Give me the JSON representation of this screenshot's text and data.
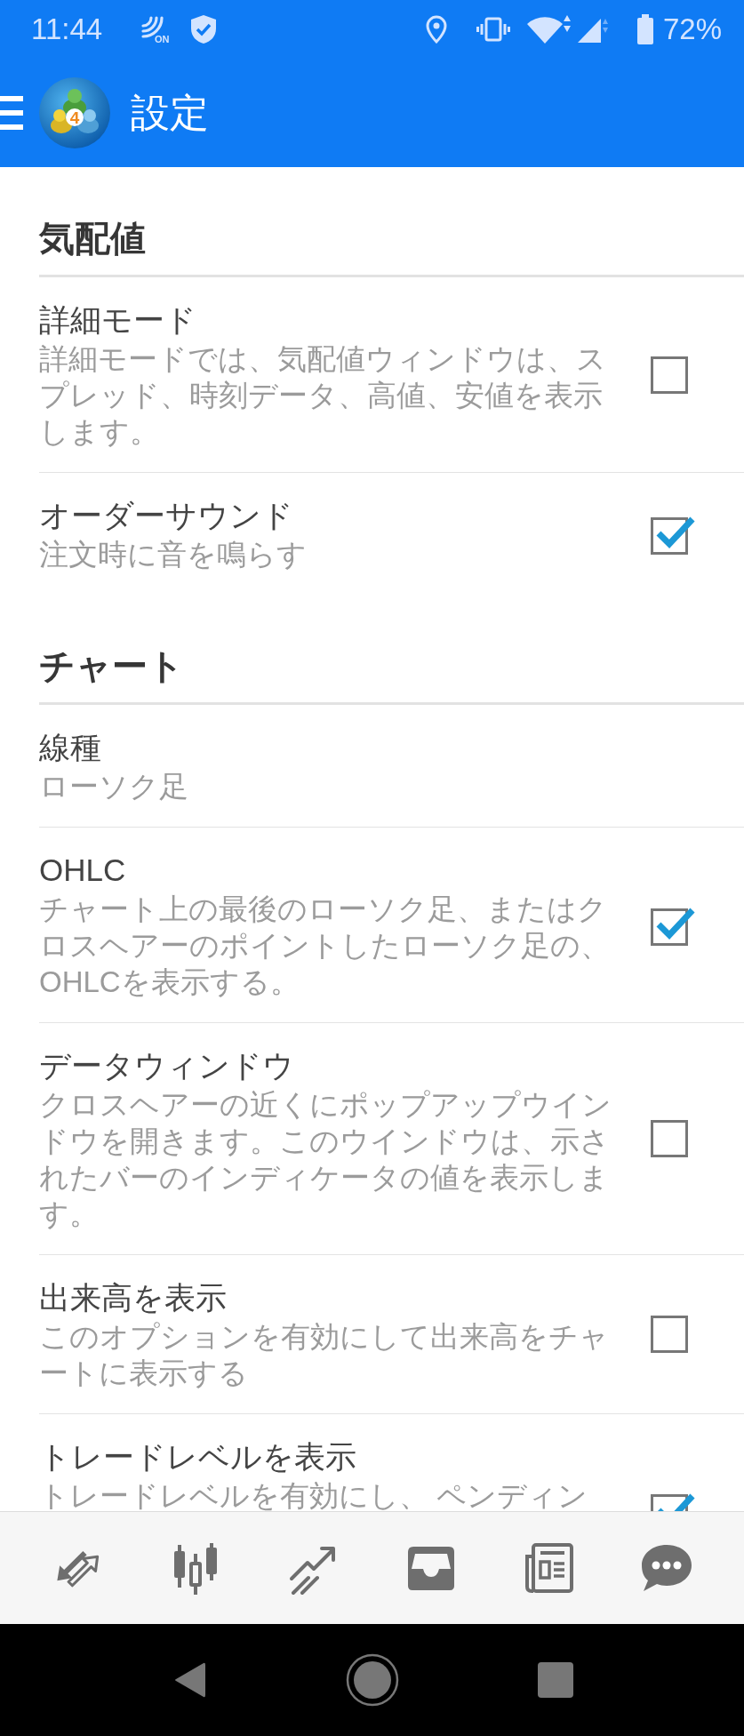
{
  "status_bar": {
    "time": "11:44",
    "nfc_label": "ON",
    "battery": "72%"
  },
  "app_bar": {
    "logo_badge": "4",
    "title": "設定"
  },
  "sections": [
    {
      "title": "気配値",
      "items": [
        {
          "kind": "checkbox",
          "title": "詳細モード",
          "description": "詳細モードでは、気配値ウィンドウは、スプレッド、時刻データ、高値、安値を表示します。",
          "checked": false
        },
        {
          "kind": "checkbox",
          "title": "オーダーサウンド",
          "description": "注文時に音を鳴らす",
          "checked": true
        }
      ]
    },
    {
      "title": "チャート",
      "items": [
        {
          "kind": "value",
          "title": "線種",
          "value": "ローソク足"
        },
        {
          "kind": "checkbox",
          "title": "OHLC",
          "description": "チャート上の最後のローソク足、またはクロスヘアーのポイントしたローソク足の、OHLCを表示する。",
          "checked": true
        },
        {
          "kind": "checkbox",
          "title": "データウィンドウ",
          "description": "クロスヘアーの近くにポップアップウインドウを開きます。このウインドウは、示されたバーのインディケータの値を表示します。",
          "checked": false
        },
        {
          "kind": "checkbox",
          "title": "出来高を表示",
          "description": "このオプションを有効にして出来高をチャートに表示する",
          "checked": false
        },
        {
          "kind": "checkbox",
          "title": "トレードレベルを表示",
          "description": "トレードレベルを有効にし、 ペンディン",
          "checked": true
        }
      ]
    }
  ],
  "bottom_nav": [
    {
      "kind": "quotes",
      "selected": false
    },
    {
      "kind": "chart",
      "selected": false
    },
    {
      "kind": "trade",
      "selected": false
    },
    {
      "kind": "history",
      "selected": false
    },
    {
      "kind": "news",
      "selected": false
    },
    {
      "kind": "chat",
      "selected": false
    }
  ]
}
